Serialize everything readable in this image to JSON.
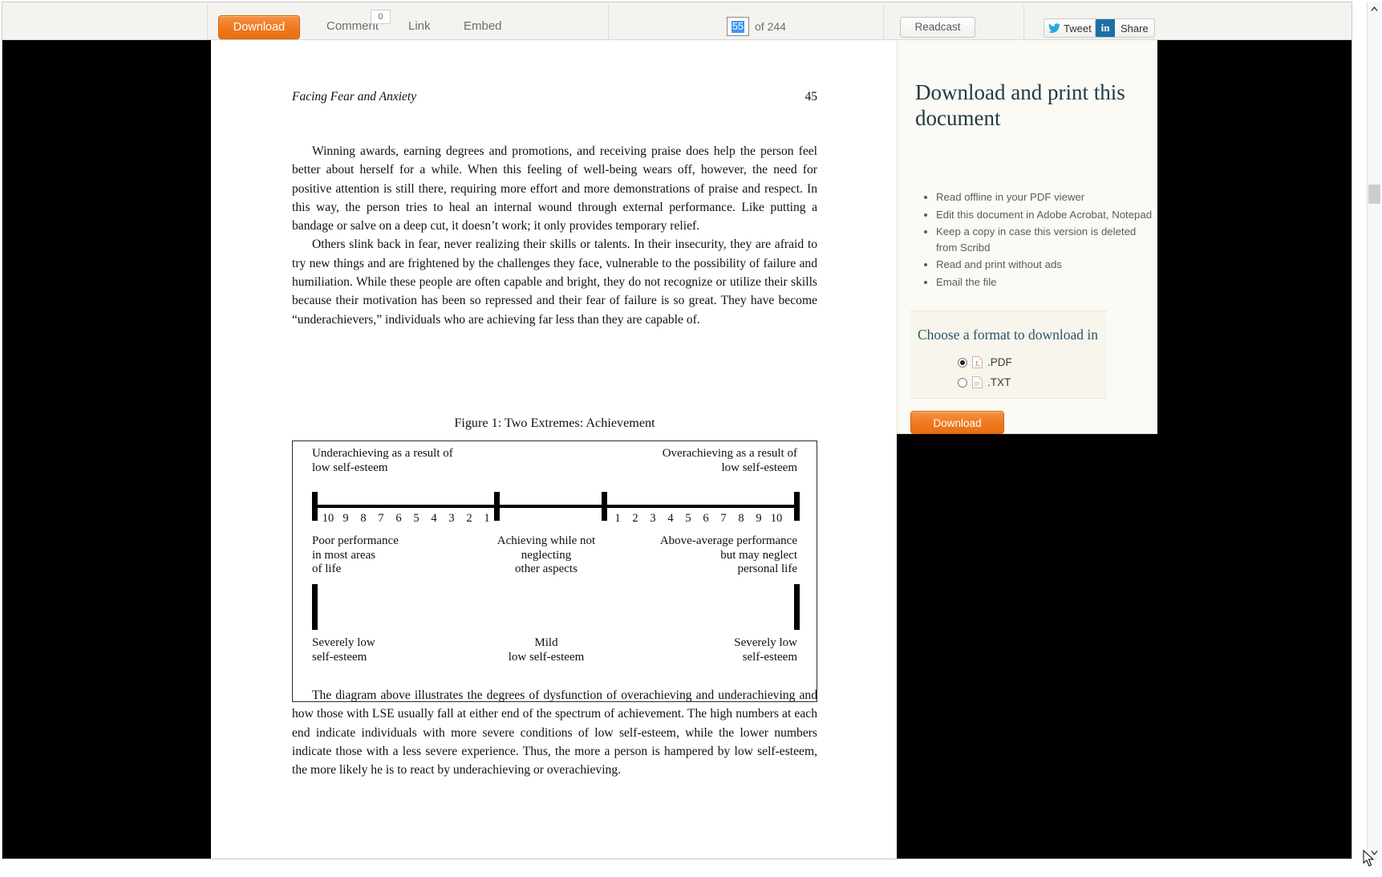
{
  "toolbar": {
    "download_label": "Download",
    "comment_label": "Comment",
    "comment_count": "0",
    "link_label": "Link",
    "embed_label": "Embed",
    "page_current": "55",
    "page_total_label": "of 244",
    "readcast_label": "Readcast",
    "tweet_label": "Tweet",
    "share_label": "Share",
    "linkedin_badge": "in",
    "accent_orange": "#ef7a21",
    "selection_blue": "#3d97f4"
  },
  "document": {
    "running_head": "Facing Fear and Anxiety",
    "page_number": "45",
    "paragraphs": [
      "Winning awards, earning degrees and promotions, and receiving praise does help the person feel better about herself for a while. When this feeling of well-being wears off, however, the need for positive attention is still there, requiring more effort and more demonstrations of praise and respect. In this way, the person tries to heal an internal wound through external performance. Like putting a bandage or salve on a deep cut, it doesn’t work; it only provides temporary relief.",
      "Others slink back in fear, never realizing their skills or talents. In their insecurity, they are afraid to try new things and are frightened by the challenges they face, vulnerable to the possibility of failure and humiliation. While these people are often capable and bright, they do not recognize or utilize their skills because their motivation has been so repressed and their fear of failure is so great. They have become “underachievers,” individuals who are achieving far less than they are capable of."
    ],
    "figure_caption": "Figure 1: Two Extremes: Achievement",
    "closing_paragraph": "The diagram above illustrates the degrees of dysfunction of overachieving and underachieving and how those with LSE usually fall at either end of the spectrum of achievement. The high numbers at each end indicate individuals with more severe conditions of low self-esteem, while the lower numbers indicate those with a less severe experience. Thus, the more a person is hampered by low self-esteem, the more likely he is to react by underachieving or overachieving."
  },
  "chart_data": {
    "type": "diagram",
    "title": "Figure 1: Two Extremes: Achievement",
    "top_labels": {
      "left": "Underachieving as a result of\nlow self-esteem",
      "right": "Overachieving as a result of\nlow self-esteem"
    },
    "left_scale": [
      "10",
      "9",
      "8",
      "7",
      "6",
      "5",
      "4",
      "3",
      "2",
      "1"
    ],
    "right_scale": [
      "1",
      "2",
      "3",
      "4",
      "5",
      "6",
      "7",
      "8",
      "9",
      "10"
    ],
    "mid_labels": {
      "left": "Poor performance\nin most areas\nof life",
      "center": "Achieving while not\nneglecting\nother aspects",
      "right": "Above-average performance\nbut may neglect\npersonal life"
    },
    "bottom_labels": {
      "left": "Severely low\nself-esteem",
      "center": "Mild\nlow self-esteem",
      "right": "Severely low\nself-esteem"
    }
  },
  "aside": {
    "heading": "Download and print this document",
    "benefits": [
      "Read offline in your PDF viewer",
      "Edit this document in Adobe Acrobat, Notepad",
      "Keep a copy in case this version is deleted from Scribd",
      "Read and print without ads",
      "Email the file"
    ],
    "format_title": "Choose a format to download in",
    "format_pdf": ".PDF",
    "format_txt": ".TXT",
    "download_label": "Download",
    "heading_color": "#1f3a45"
  }
}
